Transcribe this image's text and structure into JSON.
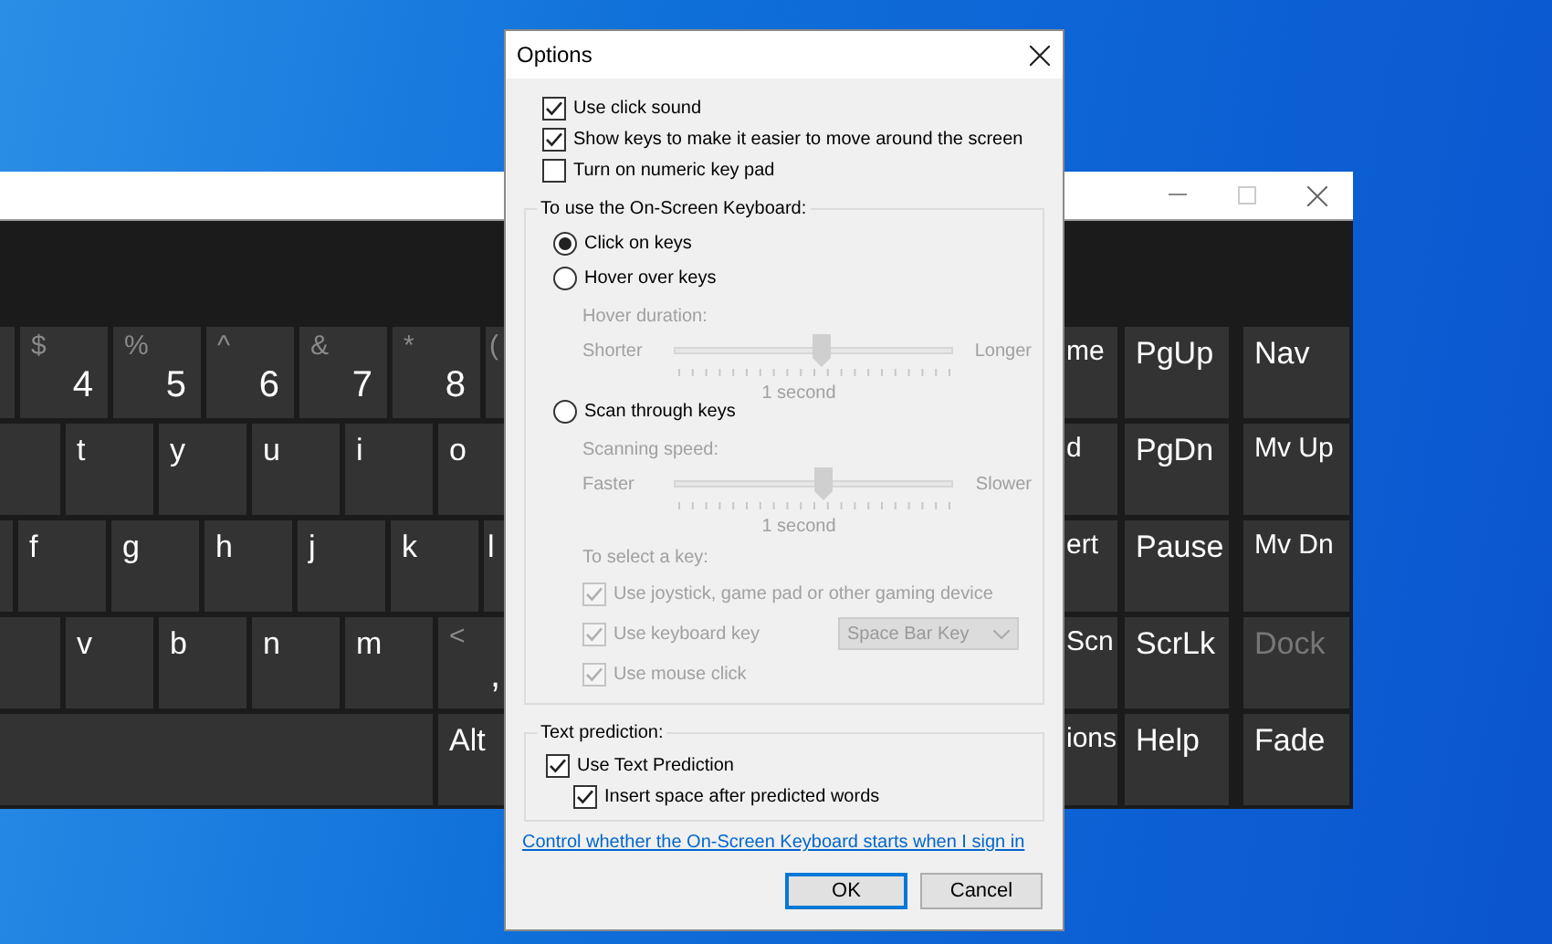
{
  "keyboard": {
    "left_rows": [
      [
        {
          "kind": "partial"
        },
        {
          "kind": "full",
          "shift": "$",
          "label": "4"
        },
        {
          "kind": "full",
          "shift": "%",
          "label": "5"
        },
        {
          "kind": "full",
          "shift": "^",
          "label": "6"
        },
        {
          "kind": "full",
          "shift": "&",
          "label": "7"
        },
        {
          "kind": "full",
          "shift": "*",
          "label": "8"
        },
        {
          "kind": "partial",
          "shift": "("
        }
      ],
      [
        {
          "kind": "partial"
        },
        {
          "kind": "full",
          "label": "t"
        },
        {
          "kind": "full",
          "label": "y"
        },
        {
          "kind": "full",
          "label": "u"
        },
        {
          "kind": "full",
          "label": "i"
        },
        {
          "kind": "partial",
          "label": "o"
        }
      ],
      [
        {
          "kind": "partial"
        },
        {
          "kind": "full",
          "label": "f"
        },
        {
          "kind": "full",
          "label": "g"
        },
        {
          "kind": "full",
          "label": "h"
        },
        {
          "kind": "full",
          "label": "j"
        },
        {
          "kind": "full",
          "label": "k"
        },
        {
          "kind": "partial",
          "label": "l"
        }
      ],
      [
        {
          "kind": "partial"
        },
        {
          "kind": "full",
          "label": "v"
        },
        {
          "kind": "full",
          "label": "b"
        },
        {
          "kind": "full",
          "label": "n"
        },
        {
          "kind": "full",
          "label": "m"
        },
        {
          "kind": "partial",
          "shift": "<",
          "label": ","
        }
      ],
      [
        {
          "kind": "wide"
        },
        {
          "kind": "partial",
          "label": "Alt"
        }
      ]
    ],
    "right_rows": [
      [
        {
          "kind": "partial",
          "label": "me",
          "disabled": false
        },
        {
          "kind": "full",
          "label": "PgUp",
          "disabled": false
        },
        {
          "kind": "full",
          "label": "Nav",
          "disabled": false
        }
      ],
      [
        {
          "kind": "partial",
          "label": "d",
          "disabled": false
        },
        {
          "kind": "full",
          "label": "PgDn",
          "disabled": false
        },
        {
          "kind": "full",
          "label": "Mv Up",
          "disabled": false
        }
      ],
      [
        {
          "kind": "partial",
          "label": "ert",
          "disabled": false
        },
        {
          "kind": "full",
          "label": "Pause",
          "disabled": false
        },
        {
          "kind": "full",
          "label": "Mv Dn",
          "disabled": false
        }
      ],
      [
        {
          "kind": "partial",
          "label": "Scn",
          "disabled": false
        },
        {
          "kind": "full",
          "label": "ScrLk",
          "disabled": false
        },
        {
          "kind": "full",
          "label": "Dock",
          "disabled": true
        }
      ],
      [
        {
          "kind": "partial",
          "label": "ions",
          "disabled": false
        },
        {
          "kind": "full",
          "label": "Help",
          "disabled": false
        },
        {
          "kind": "full",
          "label": "Fade",
          "disabled": false
        }
      ]
    ]
  },
  "dialog": {
    "title": "Options",
    "options": [
      {
        "label": "Use click sound",
        "checked": true
      },
      {
        "label": "Show keys to make it easier to move around the screen",
        "checked": true
      },
      {
        "label": "Turn on numeric key pad",
        "checked": false
      }
    ],
    "mode_group": {
      "title": "To use the On-Screen Keyboard:",
      "items": [
        {
          "kind": "radio",
          "label": "Click on keys",
          "selected": true
        },
        {
          "kind": "radio",
          "label": "Hover over keys",
          "selected": false
        },
        {
          "kind": "caption",
          "label": "Hover duration:",
          "disabled": true
        },
        {
          "kind": "slider",
          "min_label": "Shorter",
          "max_label": "Longer",
          "level": 0.53,
          "reading": "1 second",
          "disabled": true
        },
        {
          "kind": "radio",
          "label": "Scan through keys",
          "selected": false
        },
        {
          "kind": "caption",
          "label": "Scanning speed:",
          "disabled": true
        },
        {
          "kind": "slider",
          "min_label": "Faster",
          "max_label": "Slower",
          "level": 0.53,
          "reading": "1 second",
          "disabled": true
        },
        {
          "kind": "caption",
          "label": "To select a key:",
          "disabled": true
        },
        {
          "kind": "checkbox",
          "label": "Use joystick, game pad or other gaming device",
          "checked": true,
          "disabled": true
        },
        {
          "kind": "checkbox",
          "label": "Use keyboard key",
          "checked": true,
          "disabled": true,
          "select": "Space Bar Key"
        },
        {
          "kind": "checkbox",
          "label": "Use mouse click",
          "checked": true,
          "disabled": true
        }
      ]
    },
    "prediction_group": {
      "title": "Text prediction:",
      "items": [
        {
          "label": "Use Text Prediction",
          "checked": true,
          "children": [
            {
              "label": "Insert space after predicted words",
              "checked": true
            }
          ]
        }
      ]
    },
    "link": "Control whether the On-Screen Keyboard starts when I sign in",
    "buttons": [
      {
        "label": "OK",
        "default": true
      },
      {
        "label": "Cancel",
        "default": false
      }
    ]
  }
}
